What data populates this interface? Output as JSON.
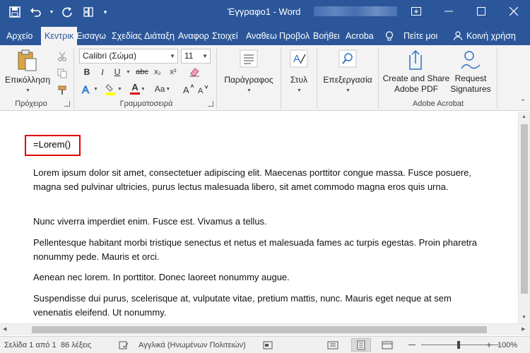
{
  "window": {
    "doc_name": "Έγγραφο1 - Word"
  },
  "tabs": [
    {
      "label": "Αρχείο"
    },
    {
      "label": "Κεντρικ"
    },
    {
      "label": "Εισαγω"
    },
    {
      "label": "Σχεδίας"
    },
    {
      "label": "Διάταξη"
    },
    {
      "label": "Αναφορ"
    },
    {
      "label": "Στοιχεί"
    },
    {
      "label": "Αναθεω"
    },
    {
      "label": "Προβολ"
    },
    {
      "label": "Βοήθει"
    },
    {
      "label": "Acroba"
    },
    {
      "label": "Πείτε μοι"
    },
    {
      "label": "Κοινή χρήση"
    }
  ],
  "ribbon": {
    "paste_label": "Επικόλληση",
    "clipboard_group": "Πρόχειρο",
    "font_name": "Calibri (Σώμα)",
    "font_size": "11",
    "font_group": "Γραμματοσειρά",
    "paragraph_label": "Παράγραφος",
    "styles_label": "Στυλ",
    "editing_label": "Επεξεργασία",
    "create_pdf_line1": "Create and Share",
    "create_pdf_line2": "Adobe PDF",
    "request_sig_line1": "Request",
    "request_sig_line2": "Signatures",
    "acrobat_group": "Adobe Acrobat",
    "font_buttons": {
      "bold": "B",
      "italic": "I",
      "underline": "U",
      "strike": "abc",
      "subscript": "x₂",
      "superscript": "x²",
      "font_color": "A",
      "size_aa": "Aa"
    },
    "colors": {
      "accent": "#2b579a",
      "highlight": "#ffff00",
      "font_color": "#e00000"
    }
  },
  "document": {
    "command": "=Lorem()",
    "paragraphs": [
      "Lorem ipsum dolor sit amet, consectetuer adipiscing elit. Maecenas porttitor congue massa. Fusce posuere, magna sed pulvinar ultricies, purus lectus malesuada libero, sit amet commodo magna eros quis urna.",
      "Nunc viverra imperdiet enim. Fusce est. Vivamus a tellus.",
      "Pellentesque habitant morbi tristique senectus et netus et malesuada fames ac turpis egestas. Proin pharetra nonummy pede. Mauris et orci.",
      "Aenean nec lorem. In porttitor. Donec laoreet nonummy augue.",
      "Suspendisse dui purus, scelerisque at, vulputate vitae, pretium mattis, nunc. Mauris eget neque at sem venenatis eleifend. Ut nonummy."
    ]
  },
  "status": {
    "page": "Σελίδα 1 από 1",
    "words": "86 λέξεις",
    "language": "Αγγλικά (Ηνωμένων Πολιτειών)",
    "zoom": "100%"
  }
}
